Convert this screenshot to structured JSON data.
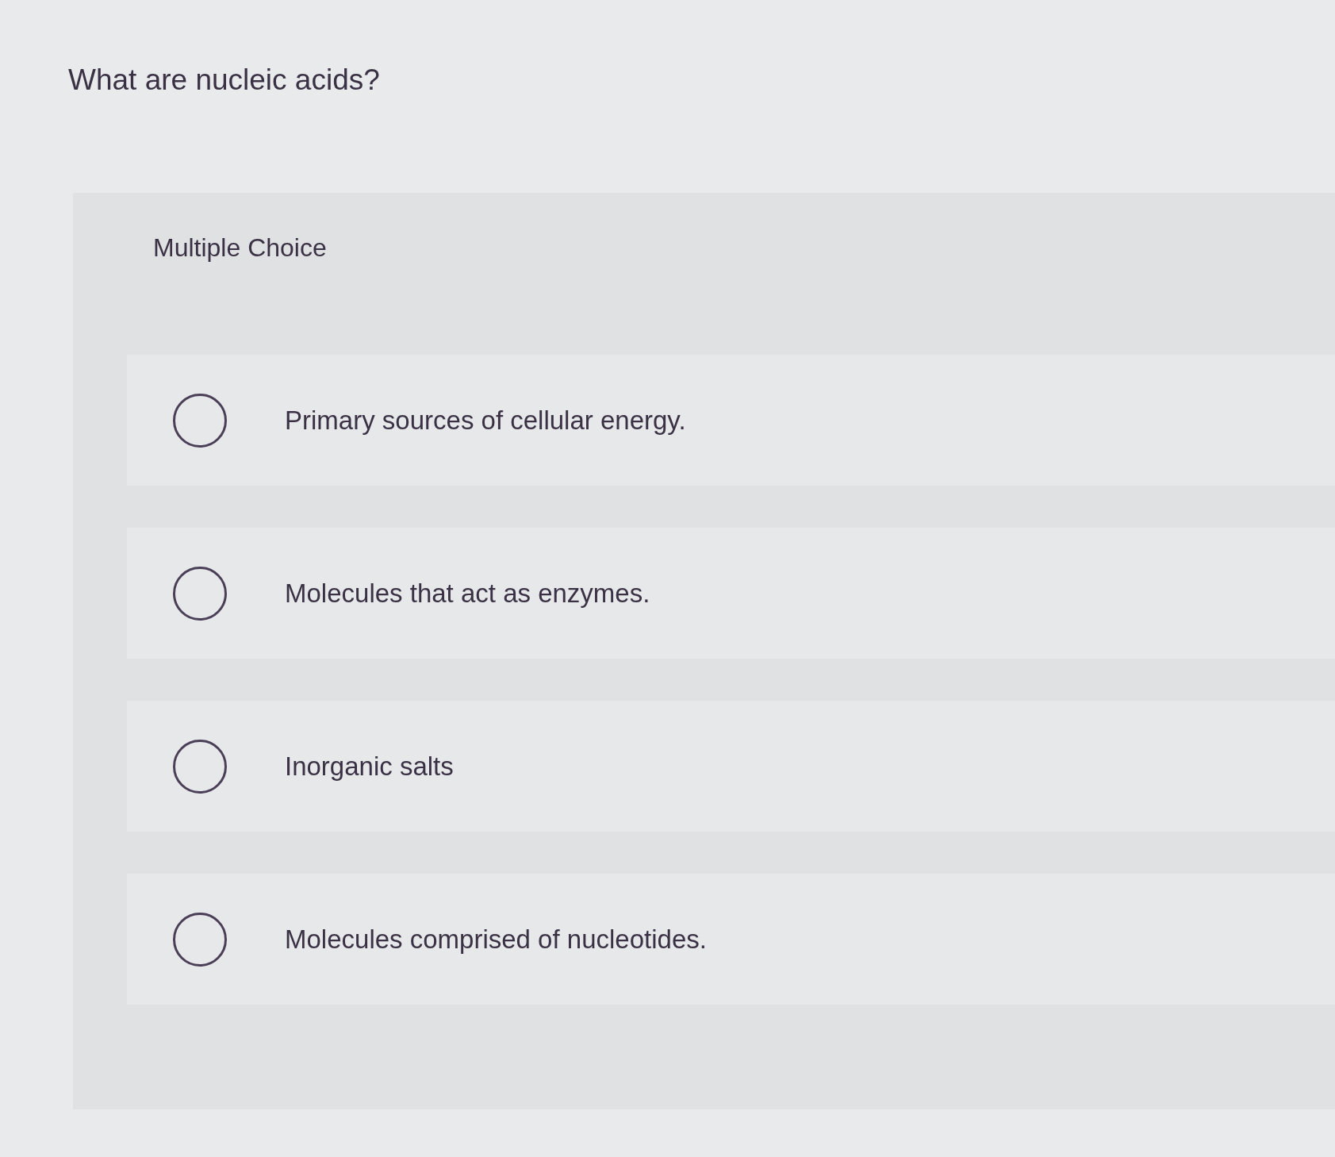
{
  "question": "What are nucleic acids?",
  "panel": {
    "type_label": "Multiple Choice",
    "options": [
      {
        "text": "Primary sources of cellular energy.",
        "selected": false
      },
      {
        "text": "Molecules that act as enzymes.",
        "selected": false
      },
      {
        "text": "Inorganic salts",
        "selected": false
      },
      {
        "text": "Molecules comprised of nucleotides.",
        "selected": false
      }
    ]
  }
}
